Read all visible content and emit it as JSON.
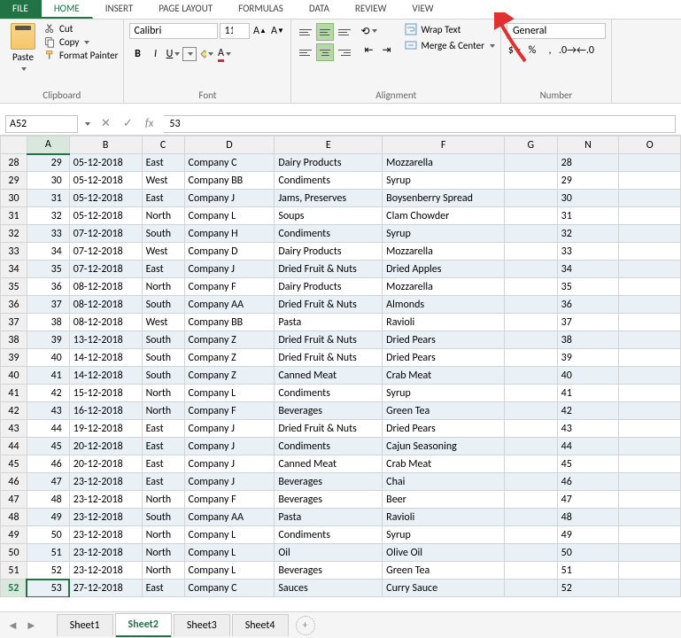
{
  "tabs": {
    "file": "FILE",
    "home": "HOME",
    "insert": "INSERT",
    "page_layout": "PAGE LAYOUT",
    "formulas": "FORMULAS",
    "data": "DATA",
    "review": "REVIEW",
    "view": "VIEW"
  },
  "clipboard": {
    "paste": "Paste",
    "cut": "Cut",
    "copy": "Copy",
    "format_painter": "Format Painter",
    "group": "Clipboard"
  },
  "font": {
    "name": "Calibri",
    "size": "11",
    "group": "Font"
  },
  "alignment": {
    "wrap": "Wrap Text",
    "merge": "Merge & Center",
    "group": "Alignment"
  },
  "number": {
    "format": "General",
    "group": "Number"
  },
  "namebox": "A52",
  "formula": "53",
  "col_headers": [
    "A",
    "B",
    "C",
    "D",
    "E",
    "F",
    "G",
    "N",
    "O"
  ],
  "rows": [
    {
      "n": 28,
      "a": "29",
      "b": "05-12-2018",
      "c": "East",
      "d": "Company C",
      "e": "Dairy Products",
      "f": "Mozzarella",
      "band": true
    },
    {
      "n": 29,
      "a": "30",
      "b": "05-12-2018",
      "c": "West",
      "d": "Company BB",
      "e": "Condiments",
      "f": "Syrup"
    },
    {
      "n": 30,
      "a": "31",
      "b": "05-12-2018",
      "c": "East",
      "d": "Company J",
      "e": "Jams, Preserves",
      "f": "Boysenberry Spread",
      "band": true
    },
    {
      "n": 31,
      "a": "32",
      "b": "05-12-2018",
      "c": "North",
      "d": "Company L",
      "e": "Soups",
      "f": "Clam Chowder"
    },
    {
      "n": 32,
      "a": "33",
      "b": "07-12-2018",
      "c": "South",
      "d": "Company H",
      "e": "Condiments",
      "f": "Syrup",
      "band": true
    },
    {
      "n": 33,
      "a": "34",
      "b": "07-12-2018",
      "c": "West",
      "d": "Company D",
      "e": "Dairy Products",
      "f": "Mozzarella"
    },
    {
      "n": 34,
      "a": "35",
      "b": "07-12-2018",
      "c": "East",
      "d": "Company J",
      "e": "Dried Fruit & Nuts",
      "f": "Dried Apples",
      "band": true
    },
    {
      "n": 35,
      "a": "36",
      "b": "08-12-2018",
      "c": "North",
      "d": "Company F",
      "e": "Dairy Products",
      "f": "Mozzarella"
    },
    {
      "n": 36,
      "a": "37",
      "b": "08-12-2018",
      "c": "South",
      "d": "Company AA",
      "e": "Dried Fruit & Nuts",
      "f": "Almonds",
      "band": true
    },
    {
      "n": 37,
      "a": "38",
      "b": "08-12-2018",
      "c": "West",
      "d": "Company BB",
      "e": "Pasta",
      "f": "Ravioli"
    },
    {
      "n": 38,
      "a": "39",
      "b": "13-12-2018",
      "c": "South",
      "d": "Company Z",
      "e": "Dried Fruit & Nuts",
      "f": "Dried Pears",
      "band": true
    },
    {
      "n": 39,
      "a": "40",
      "b": "14-12-2018",
      "c": "South",
      "d": "Company Z",
      "e": "Dried Fruit & Nuts",
      "f": "Dried Pears"
    },
    {
      "n": 40,
      "a": "41",
      "b": "14-12-2018",
      "c": "South",
      "d": "Company Z",
      "e": "Canned Meat",
      "f": "Crab Meat",
      "band": true
    },
    {
      "n": 41,
      "a": "42",
      "b": "15-12-2018",
      "c": "North",
      "d": "Company L",
      "e": "Condiments",
      "f": "Syrup"
    },
    {
      "n": 42,
      "a": "43",
      "b": "16-12-2018",
      "c": "North",
      "d": "Company F",
      "e": "Beverages",
      "f": "Green Tea",
      "band": true
    },
    {
      "n": 43,
      "a": "44",
      "b": "19-12-2018",
      "c": "East",
      "d": "Company J",
      "e": "Dried Fruit & Nuts",
      "f": "Dried Pears"
    },
    {
      "n": 44,
      "a": "45",
      "b": "20-12-2018",
      "c": "East",
      "d": "Company J",
      "e": "Condiments",
      "f": "Cajun Seasoning",
      "band": true
    },
    {
      "n": 45,
      "a": "46",
      "b": "20-12-2018",
      "c": "East",
      "d": "Company J",
      "e": "Canned Meat",
      "f": "Crab Meat"
    },
    {
      "n": 46,
      "a": "47",
      "b": "23-12-2018",
      "c": "East",
      "d": "Company J",
      "e": "Beverages",
      "f": "Chai",
      "band": true
    },
    {
      "n": 47,
      "a": "48",
      "b": "23-12-2018",
      "c": "North",
      "d": "Company F",
      "e": "Beverages",
      "f": "Beer"
    },
    {
      "n": 48,
      "a": "49",
      "b": "23-12-2018",
      "c": "South",
      "d": "Company AA",
      "e": "Pasta",
      "f": "Ravioli",
      "band": true
    },
    {
      "n": 49,
      "a": "50",
      "b": "23-12-2018",
      "c": "North",
      "d": "Company L",
      "e": "Condiments",
      "f": "Syrup"
    },
    {
      "n": 50,
      "a": "51",
      "b": "23-12-2018",
      "c": "North",
      "d": "Company L",
      "e": "Oil",
      "f": "Olive Oil",
      "band": true
    },
    {
      "n": 51,
      "a": "52",
      "b": "23-12-2018",
      "c": "North",
      "d": "Company L",
      "e": "Beverages",
      "f": "Green Tea"
    },
    {
      "n": 52,
      "a": "53",
      "b": "27-12-2018",
      "c": "East",
      "d": "Company C",
      "e": "Sauces",
      "f": "Curry Sauce",
      "band": true,
      "sel": true
    }
  ],
  "sheets": {
    "s1": "Sheet1",
    "s2": "Sheet2",
    "s3": "Sheet3",
    "s4": "Sheet4"
  }
}
